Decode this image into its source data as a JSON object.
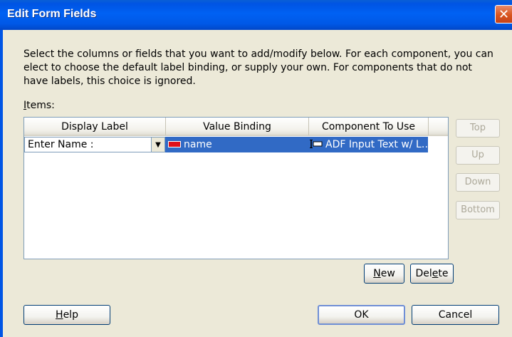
{
  "window": {
    "title": "Edit Form Fields"
  },
  "description": "Select the columns or fields that you want to add/modify below. For each component, you can elect to choose the default label binding, or supply your own. For components that do not have labels, this choice is ignored.",
  "items_label": {
    "mnemonic": "I",
    "rest": "tems:"
  },
  "table": {
    "headers": [
      "Display Label",
      "Value Binding",
      "Component To Use"
    ],
    "rows": [
      {
        "display_label": "Enter Name :",
        "value_binding": "name",
        "component": "ADF Input Text w/ L…"
      }
    ]
  },
  "side_buttons": {
    "top": "Top",
    "up": "Up",
    "down": "Down",
    "bottom": "Bottom"
  },
  "buttons": {
    "new_mn": "N",
    "new_rest": "ew",
    "delete_pre": "Del",
    "delete_mn": "e",
    "delete_rest": "te",
    "help_mn": "H",
    "help_rest": "elp",
    "ok": "OK",
    "cancel": "Cancel"
  },
  "colors": {
    "selection": "#316ac5",
    "titlebar": "#0058e6",
    "dialog_bg": "#ece9d8"
  }
}
